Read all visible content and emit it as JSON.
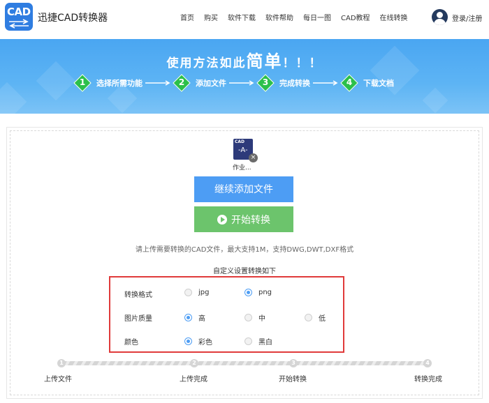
{
  "header": {
    "logo_text": "CAD",
    "brand": "迅捷CAD转换器",
    "nav": [
      "首页",
      "购买",
      "软件下载",
      "软件帮助",
      "每日一图",
      "CAD教程",
      "在线转换"
    ],
    "login": "登录/注册"
  },
  "banner": {
    "title_part1": "使用方法如此",
    "title_big": "简单",
    "title_part2": "！！！",
    "steps": [
      {
        "num": "1",
        "label": "选择所需功能"
      },
      {
        "num": "2",
        "label": "添加文件"
      },
      {
        "num": "3",
        "label": "完成转换"
      },
      {
        "num": "4",
        "label": "下载文档"
      }
    ]
  },
  "file": {
    "thumb_text": "CAD",
    "thumb_big": "-A-",
    "name": "作业...",
    "remove": "×"
  },
  "buttons": {
    "add": "继续添加文件",
    "start": "开始转换"
  },
  "hint": "请上传需要转换的CAD文件，最大支持1M，支持DWG,DWT,DXF格式",
  "settings": {
    "title": "自定义设置转换如下",
    "format": {
      "label": "转换格式",
      "options": [
        "jpg",
        "png"
      ],
      "selected": "png"
    },
    "quality": {
      "label": "图片质量",
      "options": [
        "高",
        "中",
        "低"
      ],
      "selected": "高"
    },
    "color": {
      "label": "颜色",
      "options": [
        "彩色",
        "黑白"
      ],
      "selected": "彩色"
    }
  },
  "progress": {
    "nodes": [
      "1",
      "2",
      "3",
      "4"
    ],
    "labels": [
      "上传文件",
      "上传完成",
      "开始转换",
      "转换完成"
    ]
  },
  "colors": {
    "primary": "#4d9df4",
    "green": "#6cc46c",
    "highlight": "#e03a3a"
  }
}
